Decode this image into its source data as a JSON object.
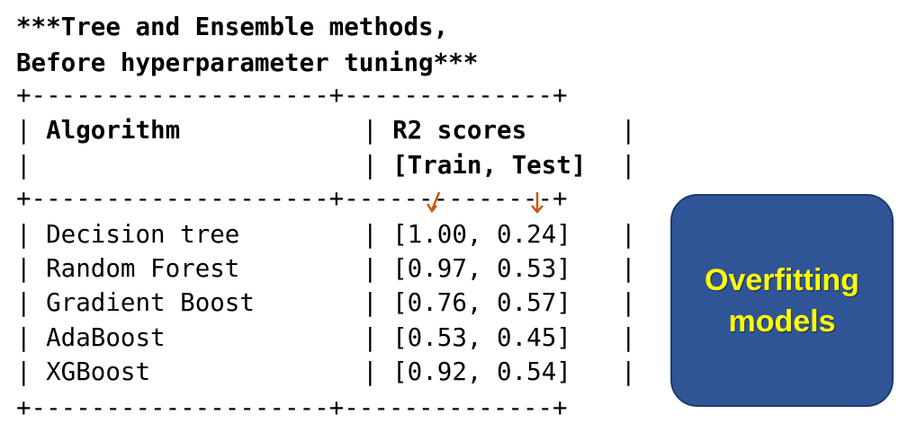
{
  "title": {
    "line1": "***Tree and Ensemble methods,",
    "line2": "Before hyperparameter tuning***"
  },
  "table": {
    "border_line": "+--------------------+--------------+",
    "header": {
      "algorithm": "Algorithm",
      "scores_line1": "R2 scores",
      "scores_line2": "[Train, Test]"
    },
    "rows": [
      {
        "algorithm": "Decision tree",
        "scores": "[1.00, 0.24]"
      },
      {
        "algorithm": "Random Forest",
        "scores": "[0.97, 0.53]"
      },
      {
        "algorithm": "Gradient Boost",
        "scores": "[0.76, 0.57]"
      },
      {
        "algorithm": "AdaBoost",
        "scores": "[0.53, 0.45]"
      },
      {
        "algorithm": "XGBoost",
        "scores": "[0.92, 0.54]"
      }
    ]
  },
  "callout": {
    "line1": "Overfitting",
    "line2": "models",
    "text_color": "#ffff00",
    "background_color": "#2f5597"
  },
  "annotation": {
    "arrow_color": "#c55a11",
    "arrow_icon": "down-arrow-icon"
  }
}
